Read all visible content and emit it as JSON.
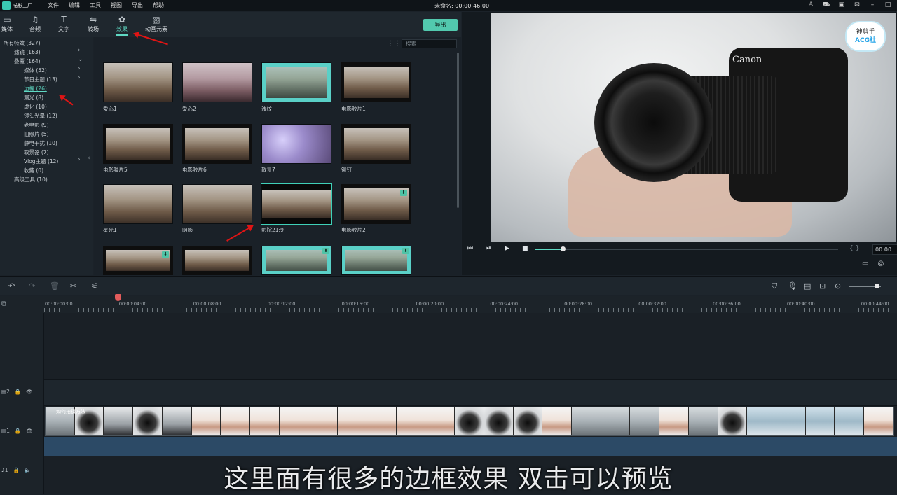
{
  "app": {
    "logo_text": "喵影工厂",
    "title": "未命名: 00:00:46:00"
  },
  "menu": [
    "文件",
    "编辑",
    "工具",
    "视图",
    "导出",
    "帮助"
  ],
  "toolbar": {
    "tabs": [
      {
        "label": "媒体",
        "icon": "folder-icon"
      },
      {
        "label": "音频",
        "icon": "music-icon"
      },
      {
        "label": "文字",
        "icon": "text-icon"
      },
      {
        "label": "转场",
        "icon": "transition-icon"
      },
      {
        "label": "效果",
        "icon": "effect-icon",
        "active": true
      },
      {
        "label": "动画元素",
        "icon": "image-icon"
      }
    ],
    "export_label": "导出"
  },
  "sidebar": {
    "items": [
      {
        "label": "所有特效 (327)"
      },
      {
        "label": "滤镜 (163)",
        "chevron": true
      },
      {
        "label": "叠覆 (164)",
        "chevron": true
      },
      {
        "label": "媒体 (52)",
        "chevron": true
      },
      {
        "label": "节日主题 (13)",
        "chevron": true
      },
      {
        "label": "边框 (26)",
        "selected": true
      },
      {
        "label": "漏光 (8)"
      },
      {
        "label": "虚化 (10)"
      },
      {
        "label": "镜头光晕 (12)"
      },
      {
        "label": "老电影 (9)"
      },
      {
        "label": "旧照片 (5)"
      },
      {
        "label": "静电干扰 (10)"
      },
      {
        "label": "取景器 (7)"
      },
      {
        "label": "Vlog主题 (12)",
        "chevron": true
      },
      {
        "label": "收藏 (0)"
      },
      {
        "label": "高级工具 (10)"
      }
    ]
  },
  "grid": {
    "search_placeholder": "搜索",
    "items": [
      {
        "label": "爱心1",
        "style": "plain"
      },
      {
        "label": "爱心2",
        "style": "pink"
      },
      {
        "label": "波纹",
        "style": "teal"
      },
      {
        "label": "电影胶片1",
        "style": "film"
      },
      {
        "label": "电影胶片5",
        "style": "film"
      },
      {
        "label": "电影胶片6",
        "style": "film"
      },
      {
        "label": "散景7",
        "style": "purple"
      },
      {
        "label": "铆钉",
        "style": "film"
      },
      {
        "label": "星光1",
        "style": "plain"
      },
      {
        "label": "阴影",
        "style": "plain"
      },
      {
        "label": "影院21:9",
        "style": "bar",
        "selected": true
      },
      {
        "label": "电影胶片2",
        "style": "film",
        "download": true
      },
      {
        "label": "",
        "style": "film",
        "download": true
      },
      {
        "label": "",
        "style": "film"
      },
      {
        "label": "",
        "style": "teal",
        "download": true
      },
      {
        "label": "",
        "style": "teal",
        "download": true
      }
    ]
  },
  "preview": {
    "brand_text": "Canon",
    "watermark_line1": "神剪手",
    "watermark_line2": "ACG社",
    "timecode": "00:00",
    "progress": 0.09
  },
  "timeline": {
    "ruler_labels": [
      "00:00:00:00",
      "00:00:04:00",
      "00:00:08:00",
      "00:00:12:00",
      "00:00:16:00",
      "00:00:20:00",
      "00:00:24:00",
      "00:00:28:00",
      "00:00:32:00",
      "00:00:36:00",
      "00:00:40:00",
      "00:00:44:00"
    ],
    "track_numbers": {
      "video2": "2",
      "video1": "1",
      "audio1": "1"
    },
    "clip_label": "如何拍摄方法",
    "zoom_level": 0.8
  },
  "subtitle": "这里面有很多的边框效果  双击可以预览"
}
